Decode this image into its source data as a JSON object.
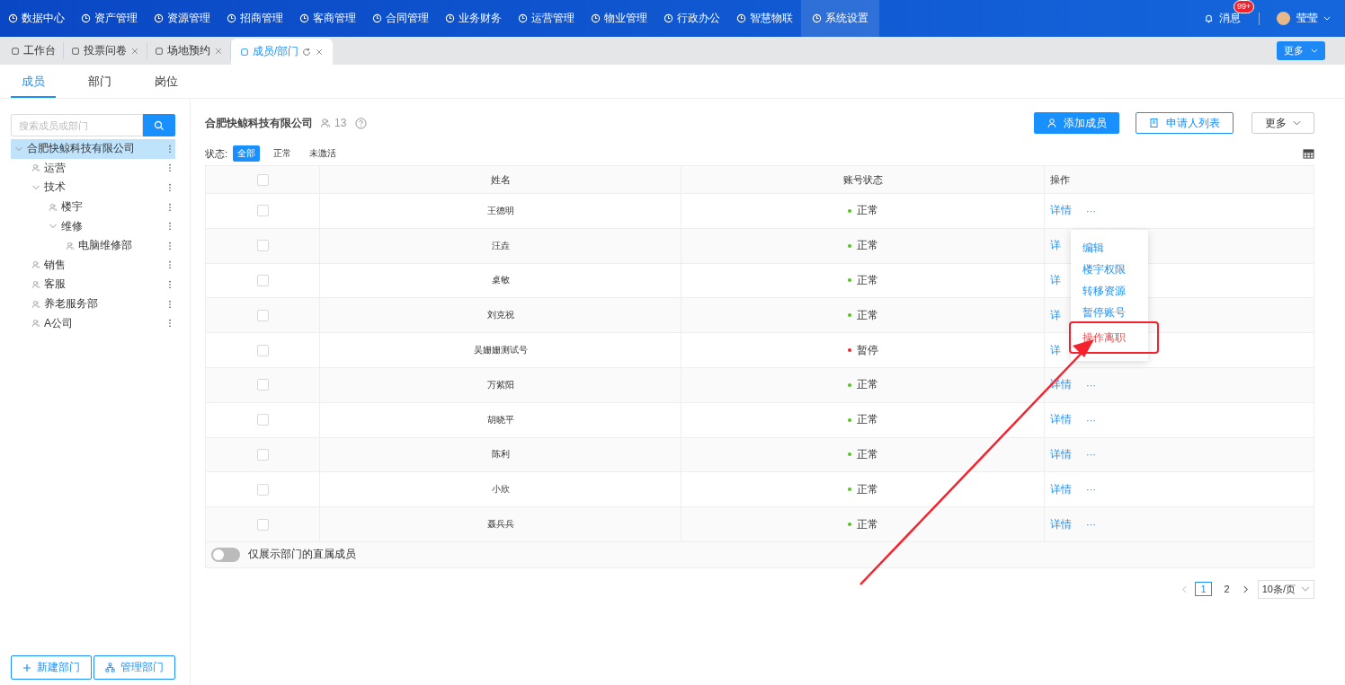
{
  "top_nav": {
    "items": [
      {
        "label": "数据中心",
        "selected": false
      },
      {
        "label": "资产管理",
        "selected": false
      },
      {
        "label": "资源管理",
        "selected": false
      },
      {
        "label": "招商管理",
        "selected": false
      },
      {
        "label": "客商管理",
        "selected": false
      },
      {
        "label": "合同管理",
        "selected": false
      },
      {
        "label": "业务财务",
        "selected": false
      },
      {
        "label": "运营管理",
        "selected": false
      },
      {
        "label": "物业管理",
        "selected": false
      },
      {
        "label": "行政办公",
        "selected": false
      },
      {
        "label": "智慧物联",
        "selected": false
      },
      {
        "label": "系统设置",
        "selected": true
      }
    ],
    "messages": {
      "label": "消息",
      "badge": "99+"
    },
    "user": {
      "name": "莹莹"
    }
  },
  "open_tabs": {
    "items": [
      {
        "label": "工作台",
        "selected": false,
        "closable": false,
        "refresh": false
      },
      {
        "label": "投票问卷",
        "selected": false,
        "closable": true,
        "refresh": false
      },
      {
        "label": "场地预约",
        "selected": false,
        "closable": true,
        "refresh": false
      },
      {
        "label": "成员/部门",
        "selected": true,
        "closable": true,
        "refresh": true
      }
    ],
    "more": "更多"
  },
  "sub_tabs": [
    {
      "label": "成员",
      "selected": true
    },
    {
      "label": "部门",
      "selected": false
    },
    {
      "label": "岗位",
      "selected": false
    }
  ],
  "sidebar": {
    "search": {
      "placeholder": "搜索成员或部门"
    },
    "tree": [
      {
        "label": "合肥快鲸科技有限公司",
        "selected": true,
        "expanded": true,
        "children": [
          {
            "label": "运营",
            "selected": false
          },
          {
            "label": "技术",
            "selected": false,
            "expanded": true,
            "children": [
              {
                "label": "楼宇",
                "selected": false
              },
              {
                "label": "维修",
                "selected": false,
                "expanded": true,
                "children": [
                  {
                    "label": "电脑维修部",
                    "selected": false
                  }
                ]
              }
            ]
          },
          {
            "label": "销售",
            "selected": false
          },
          {
            "label": "客服",
            "selected": false
          },
          {
            "label": "养老服务部",
            "selected": false
          },
          {
            "label": "A公司",
            "selected": false
          }
        ]
      }
    ],
    "buttons": [
      "新建部门",
      "管理部门"
    ]
  },
  "main": {
    "company": "合肥快鲸科技有限公司",
    "member_count": "13",
    "actions": [
      {
        "label": "添加成员",
        "kind": "primary"
      },
      {
        "label": "申请人列表",
        "kind": "outline"
      },
      {
        "label": "更多",
        "kind": "dropdown"
      }
    ],
    "filter": {
      "label": "状态:",
      "options": [
        {
          "label": "全部",
          "selected": true
        },
        {
          "label": "正常",
          "selected": false
        },
        {
          "label": "未激活",
          "selected": false
        }
      ]
    },
    "table": {
      "select_all": {
        "checked": false
      },
      "columns": [
        "姓名",
        "账号状态",
        "操作"
      ],
      "rows": [
        {
          "checked": false,
          "name": "王德明",
          "status": "正常",
          "color": "#52c41a",
          "action": "详情",
          "more": "···"
        },
        {
          "checked": false,
          "name": "汪垚",
          "status": "正常",
          "color": "#52c41a",
          "action": "详"
        },
        {
          "checked": false,
          "name": "桌敏",
          "status": "正常",
          "color": "#52c41a",
          "action": "详"
        },
        {
          "checked": false,
          "name": "刘克祝",
          "status": "正常",
          "color": "#52c41a",
          "action": "详"
        },
        {
          "checked": false,
          "name": "吴姗姗测试号",
          "status": "暂停",
          "color": "#f5222d",
          "action": "详"
        },
        {
          "checked": false,
          "name": "万紫阳",
          "status": "正常",
          "color": "#52c41a",
          "action": "详情",
          "more": "···"
        },
        {
          "checked": false,
          "name": "胡晓平",
          "status": "正常",
          "color": "#52c41a",
          "action": "详情",
          "more": "···"
        },
        {
          "checked": false,
          "name": "陈利",
          "status": "正常",
          "color": "#52c41a",
          "action": "详情",
          "more": "···"
        },
        {
          "checked": false,
          "name": "小欣",
          "status": "正常",
          "color": "#52c41a",
          "action": "详情",
          "more": "···"
        },
        {
          "checked": false,
          "name": "聂兵兵",
          "status": "正常",
          "color": "#52c41a",
          "action": "详情",
          "more": "···"
        }
      ],
      "direct_only": {
        "label": "仅展示部门的直属成员",
        "on": false
      }
    },
    "row_menu": {
      "items": [
        {
          "label": "编辑",
          "danger": false,
          "highlighted": false
        },
        {
          "label": "楼宇权限",
          "danger": false,
          "highlighted": false
        },
        {
          "label": "转移资源",
          "danger": false,
          "highlighted": false
        },
        {
          "label": "暂停账号",
          "danger": false,
          "highlighted": false
        },
        {
          "label": "操作离职",
          "danger": true,
          "highlighted": true
        }
      ]
    },
    "pagination": {
      "pages": [
        {
          "label": "1",
          "selected": true
        },
        {
          "label": "2",
          "selected": false
        }
      ],
      "page_size": "10条/页"
    }
  }
}
